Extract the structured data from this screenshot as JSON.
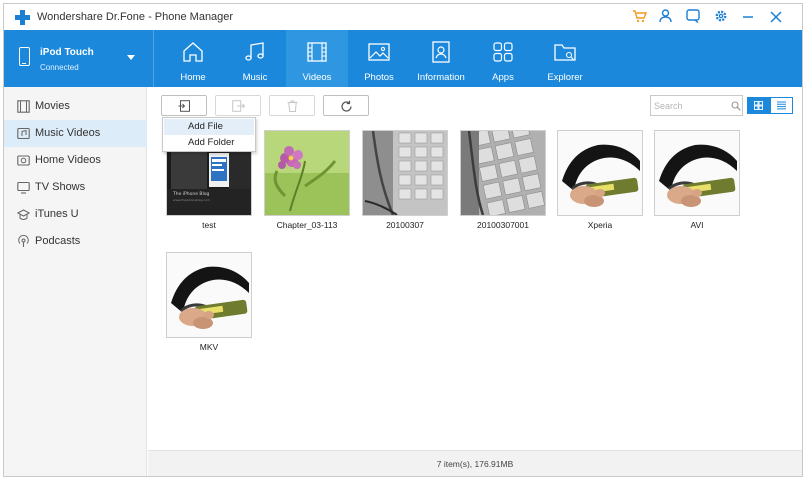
{
  "app": {
    "title": "Wondershare Dr.Fone - Phone Manager"
  },
  "titlebar_icons": [
    "cart-icon",
    "user-icon",
    "feedback-icon",
    "settings-icon",
    "minimize-icon",
    "close-icon"
  ],
  "device": {
    "name": "iPod Touch",
    "status": "Connected"
  },
  "nav": {
    "tabs": [
      {
        "label": "Home",
        "icon": "home-icon"
      },
      {
        "label": "Music",
        "icon": "music-icon"
      },
      {
        "label": "Videos",
        "icon": "video-icon",
        "active": true
      },
      {
        "label": "Photos",
        "icon": "photo-icon"
      },
      {
        "label": "Information",
        "icon": "contacts-icon"
      },
      {
        "label": "Apps",
        "icon": "apps-icon"
      },
      {
        "label": "Explorer",
        "icon": "folder-icon"
      }
    ]
  },
  "sidebar": {
    "items": [
      {
        "label": "Movies",
        "icon": "movie-icon"
      },
      {
        "label": "Music Videos",
        "icon": "music-video-icon",
        "active": true
      },
      {
        "label": "Home Videos",
        "icon": "home-video-icon"
      },
      {
        "label": "TV Shows",
        "icon": "tv-icon"
      },
      {
        "label": "iTunes U",
        "icon": "graduation-cap-icon"
      },
      {
        "label": "Podcasts",
        "icon": "podcast-icon"
      }
    ]
  },
  "toolbar": {
    "add_icon": "import-icon",
    "export_icon": "export-icon",
    "delete_icon": "trash-icon",
    "refresh_icon": "refresh-icon",
    "search_placeholder": "Search"
  },
  "add_menu": {
    "items": [
      "Add File",
      "Add Folder"
    ]
  },
  "videos": [
    {
      "name": "test",
      "thumb": "blog-screen"
    },
    {
      "name": "Chapter_03-113",
      "thumb": "flower"
    },
    {
      "name": "20100307",
      "thumb": "keyboard"
    },
    {
      "name": "20100307001",
      "thumb": "keyboard-closeup"
    },
    {
      "name": "Xperia",
      "thumb": "phone-held"
    },
    {
      "name": "AVI",
      "thumb": "phone-held"
    },
    {
      "name": "MKV",
      "thumb": "phone-held"
    }
  ],
  "status": {
    "text": "7 item(s), 176.91MB"
  },
  "colors": {
    "accent": "#1b88dc",
    "active_tab": "#2f97e2",
    "cart": "#f39a1d",
    "sidebar_active": "#dcecf9"
  }
}
